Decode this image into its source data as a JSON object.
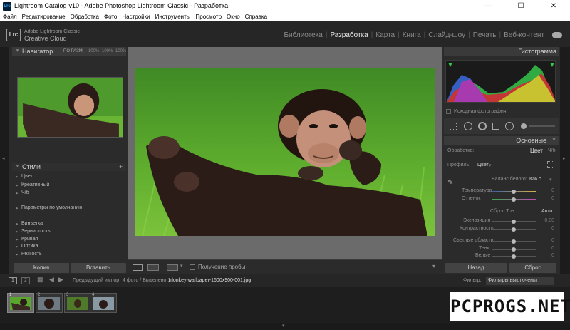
{
  "window": {
    "title": "Lightroom Catalog-v10 - Adobe Photoshop Lightroom Classic - Разработка",
    "app_icon": "Lrc",
    "minimize": "—",
    "maximize": "☐",
    "close": "✕"
  },
  "menu": [
    "Файл",
    "Редактирование",
    "Обработка",
    "Фото",
    "Настройки",
    "Инструменты",
    "Просмотр",
    "Окно",
    "Справка"
  ],
  "identity": {
    "logo": "Lrc",
    "line1": "Adobe Lightroom Classic",
    "line2": "Creative Cloud"
  },
  "modules": [
    {
      "label": "Библиотека",
      "active": false
    },
    {
      "label": "Разработка",
      "active": true
    },
    {
      "label": "Карта",
      "active": false
    },
    {
      "label": "Книга",
      "active": false
    },
    {
      "label": "Слайд-шоу",
      "active": false
    },
    {
      "label": "Печать",
      "active": false
    },
    {
      "label": "Веб-контент",
      "active": false
    }
  ],
  "navigator": {
    "title": "Навигатор",
    "zoom_fit": "ПО РАЗМ",
    "z1": "100%",
    "z2": "100%",
    "z3": "100%"
  },
  "styles": {
    "title": "Стили",
    "add": "+",
    "group1": [
      "Цвет",
      "Креативный",
      "Ч/б"
    ],
    "defaults": "Параметры по умолчанию",
    "group2": [
      "Виньетка",
      "Зернистость",
      "Кривая",
      "Оптика",
      "Резкость"
    ]
  },
  "left_buttons": {
    "copy": "Копия",
    "paste": "Вставить"
  },
  "toolbar": {
    "soft_proof": "Получение пробы"
  },
  "histogram": {
    "title": "Гистограмма",
    "original_photo": "Исходная фотография"
  },
  "basic": {
    "title": "Основные",
    "treatment_label": "Обработка:",
    "treatment_color": "Цвет",
    "treatment_bw": "Ч/б",
    "profile_label": "Профиль:",
    "profile_value": "Цвет",
    "wb_label": "Баланс белого:",
    "wb_value": "Как с...",
    "temperature": "Температура",
    "temperature_val": "0",
    "tint": "Оттенок",
    "tint_val": "0",
    "tone": "Сброс Тон",
    "auto": "Авто",
    "exposure": "Экспозиция",
    "exposure_val": "0,00",
    "contrast": "Контрастность",
    "contrast_val": "0",
    "highlights": "Светлые области",
    "highlights_val": "0",
    "shadows": "Тени",
    "shadows_val": "0",
    "whites": "Белые",
    "whites_val": "0"
  },
  "right_buttons": {
    "prev": "Назад",
    "reset": "Сброс"
  },
  "filmbar": {
    "btn1": "1",
    "btn2": "2",
    "source": "Предыдущий импорт",
    "info": "4 фото / Выделено 1 /",
    "file": "monkey-wallpaper-1600x900-001.jpg",
    "filter_label": "Фильтр:",
    "filter_value": "Фильтры выключены"
  },
  "thumbs": [
    "1",
    "2",
    "3",
    "4"
  ],
  "watermark": "PCPROGS.NET",
  "colors": {
    "accent": "#e8e8e8",
    "panel": "#2b2b2b",
    "canvas": "#6b6b6b"
  }
}
